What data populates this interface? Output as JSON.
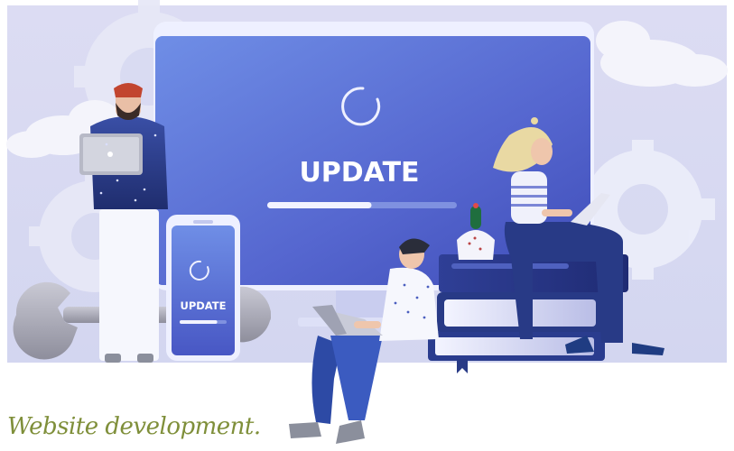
{
  "monitor": {
    "title": "UPDATE",
    "progress": 0.55
  },
  "phone": {
    "title": "UPDATE",
    "progress": 0.8
  },
  "caption": "Website development.",
  "colors": {
    "background": "#d7d9f1",
    "monitor_screen": "#5f6fd4",
    "monitor_frame": "#eef0ff",
    "navy": "#283a86",
    "caption": "#7f8f3a"
  }
}
